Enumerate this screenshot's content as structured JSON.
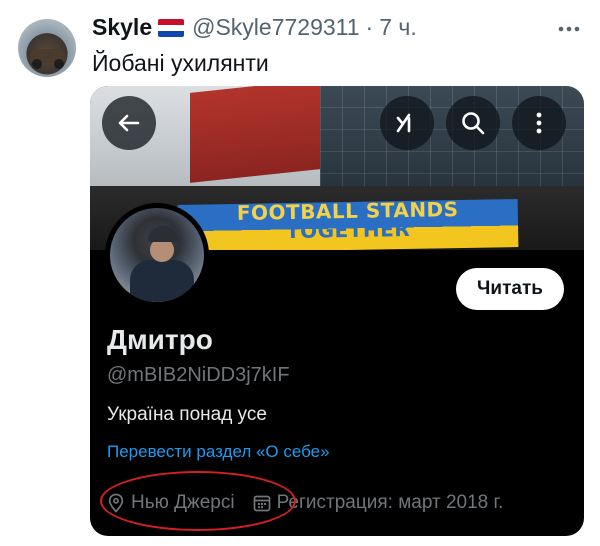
{
  "tweet": {
    "author_name": "Skyle",
    "flag_colors": [
      "#c8102e",
      "#ffffff",
      "#0f47af"
    ],
    "handle": "@Skyle7729311",
    "separator": "·",
    "time": "7 ч.",
    "more_icon": "more-horizontal-icon",
    "text": "Йобані ухилянти"
  },
  "profile_card": {
    "banner": {
      "flag_text_line1": "FOOTBALL STANDS",
      "flag_text_line2": "TOGETHER",
      "buttons": [
        "back-arrow-icon",
        "grok-icon",
        "search-icon",
        "more-vertical-icon"
      ]
    },
    "follow_label": "Читать",
    "display_name": "Дмитро",
    "handle": "@mBIB2NiDD3j7kIF",
    "bio": "Україна понад усе",
    "translate_link": "Перевести раздел «О себе»",
    "location": "Нью Джерсі",
    "joined": "Регистрация: март 2018 г.",
    "colors": {
      "background": "#000000",
      "link": "#1d9bf0",
      "secondary_text": "#71767b",
      "annotation": "#d32020"
    }
  }
}
